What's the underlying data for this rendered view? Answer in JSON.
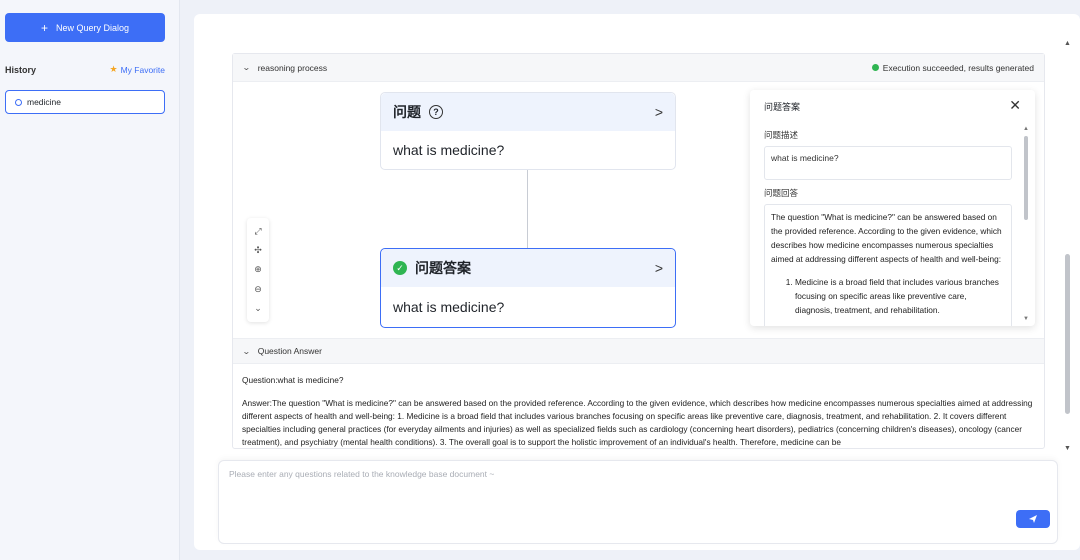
{
  "sidebar": {
    "new_button_label": "New Query Dialog",
    "history_title": "History",
    "favorite_label": "My Favorite",
    "history_items": [
      {
        "label": "medicine"
      }
    ]
  },
  "reasoning": {
    "header_label": "reasoning process",
    "status_text": "Execution succeeded, results generated",
    "status_color": "#2fb552",
    "nodes": [
      {
        "title": "问题",
        "text": "what is medicine?"
      },
      {
        "title": "问题答案",
        "text": "what is medicine?"
      }
    ],
    "toolbar_icons": [
      "fit-screen-icon",
      "center-icon",
      "zoom-in-icon",
      "zoom-out-icon",
      "collapse-icon"
    ]
  },
  "detail_panel": {
    "title": "问题答案",
    "description_label": "问题描述",
    "description_value": "what is medicine?",
    "answer_label": "问题回答",
    "answer_intro": "The question \"What is medicine?\" can be answered based on the provided reference. According to the given evidence, which describes how medicine encompasses numerous specialties aimed at addressing different aspects of health and well-being:",
    "answer_item1": "Medicine is a broad field that includes various branches focusing on specific areas like preventive care, diagnosis, treatment, and rehabilitation."
  },
  "question_answer": {
    "header_label": "Question Answer",
    "question_line": "Question:what is medicine?",
    "answer_text": "Answer:The question \"What is medicine?\" can be answered based on the provided reference. According to the given evidence, which describes how medicine encompasses numerous specialties aimed at addressing different aspects of health and well-being: 1. Medicine is a broad field that includes various branches focusing on specific areas like preventive care, diagnosis, treatment, and rehabilitation. 2. It covers different specialties including general practices (for everyday ailments and injuries) as well as specialized fields such as cardiology (concerning heart disorders), pediatrics (concerning children's diseases), oncology (cancer treatment), and psychiatry (mental health conditions). 3. The overall goal is to support the holistic improvement of an individual's health. Therefore, medicine can be"
  },
  "input": {
    "placeholder": "Please enter any questions related to the knowledge base document ~"
  },
  "colors": {
    "accent": "#3d6ef6",
    "success": "#2fb552",
    "favorite_star": "#f5a623"
  }
}
